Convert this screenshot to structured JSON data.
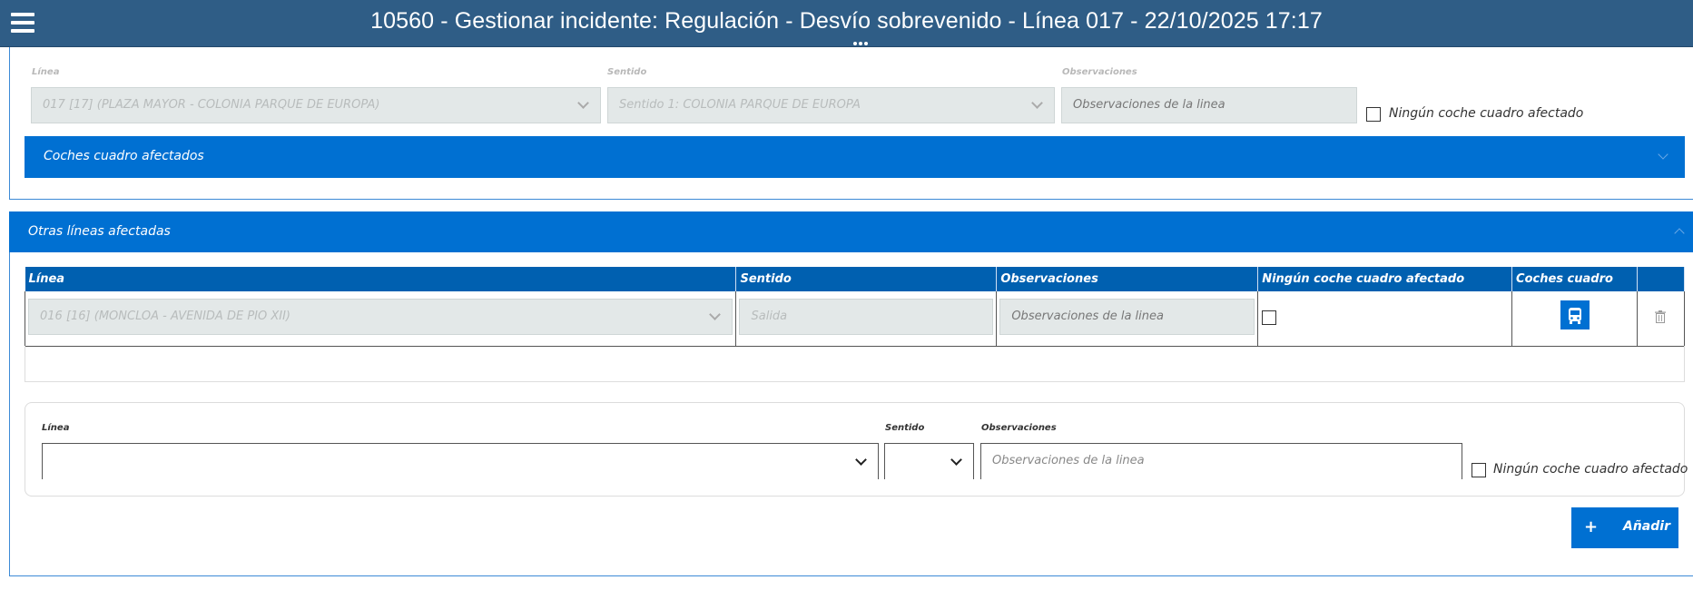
{
  "header": {
    "title": "10560 - Gestionar incidente: Regulación - Desvío sobrevenido - Línea 017 - 22/10/2025 17:17"
  },
  "main_line": {
    "linea_label": "Línea",
    "linea_value": "017 [17] (PLAZA MAYOR - COLONIA PARQUE DE EUROPA)",
    "sentido_label": "Sentido",
    "sentido_value": "Sentido 1: COLONIA PARQUE DE EUROPA",
    "observaciones_label": "Observaciones",
    "observaciones_placeholder": "Observaciones de la linea",
    "ningun_label": "Ningún coche cuadro afectado",
    "ningun_checked": false
  },
  "coches_accordion": {
    "label": "Coches cuadro afectados",
    "expanded": false
  },
  "otras_accordion": {
    "label": "Otras líneas afectadas",
    "expanded": true
  },
  "table": {
    "headers": [
      "Línea",
      "Sentido",
      "Observaciones",
      "Ningún coche cuadro afectado",
      "Coches cuadro",
      ""
    ],
    "rows": [
      {
        "linea": "016 [16] (MONCLOA - AVENIDA DE PIO XII)",
        "sentido": "Salida",
        "observaciones": "Observaciones de la linea",
        "ningun_checked": false
      }
    ]
  },
  "add_form": {
    "linea_label": "Línea",
    "linea_value": "",
    "sentido_label": "Sentido",
    "sentido_value": "",
    "observaciones_label": "Observaciones",
    "observaciones_placeholder": "Observaciones de la linea",
    "ningun_label": "Ningún coche cuadro afectado"
  },
  "add_button": {
    "label": "Añadir"
  },
  "colors": {
    "topbar": "#2f5d86",
    "accent": "#0070d2",
    "table_header": "#0060b0"
  }
}
